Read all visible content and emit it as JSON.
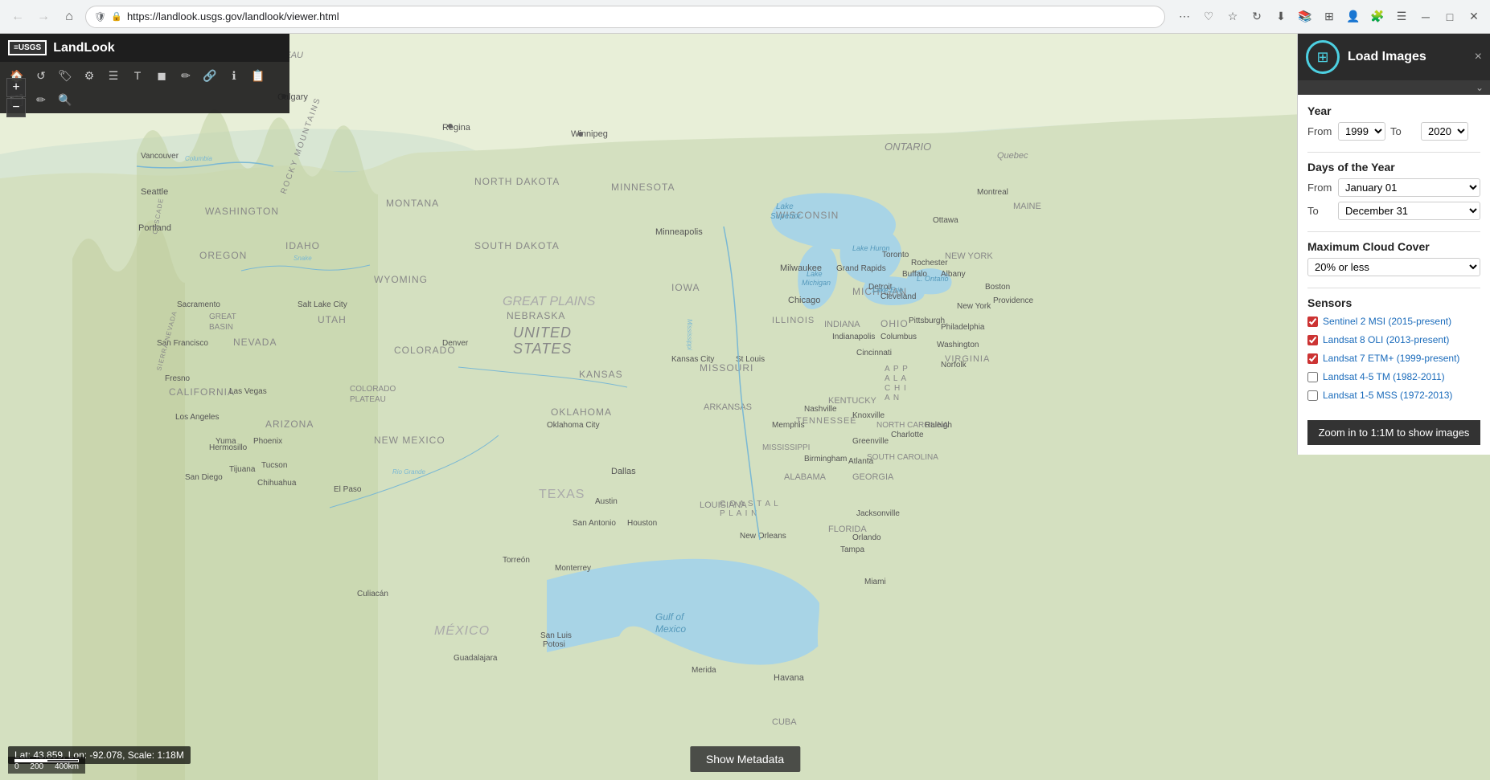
{
  "browser": {
    "url": "https://landlook.usgs.gov/landlook/viewer.html",
    "back_title": "Back",
    "forward_title": "Forward",
    "home_title": "Home",
    "refresh_title": "Refresh"
  },
  "toolbar": {
    "title": "LandLook",
    "logo_text": "≡USGS"
  },
  "panel": {
    "title": "Load Images",
    "year_label": "Year",
    "from_label": "From",
    "to_label": "To",
    "year_from": "1999",
    "year_to": "2020",
    "days_label": "Days of the Year",
    "days_from_label": "From",
    "days_from_value": "January 01",
    "days_to_label": "To",
    "days_to_value": "December 31",
    "cloud_cover_label": "Maximum Cloud Cover",
    "cloud_cover_value": "20% or less",
    "sensors_label": "Sensors",
    "sensor1_label": "Sentinel 2 MSI (2015-present)",
    "sensor2_label": "Landsat 8 OLI (2013-present)",
    "sensor3_label": "Landsat 7 ETM+ (1999-present)",
    "sensor4_label": "Landsat 4-5 TM (1982-2011)",
    "sensor5_label": "Landsat 1-5 MSS (1972-2013)",
    "zoom_btn_label": "Zoom in to 1:1M to show images",
    "close_label": "×"
  },
  "status": {
    "coordinates": "Lat: 43.859, Lon: -92.078, Scale: 1:18M"
  },
  "scale": {
    "label0": "0",
    "label1": "200",
    "label2": "400km"
  },
  "metadata_btn": "Show Metadata",
  "tools": [
    "🏠",
    "↺",
    "🏷",
    "⚙",
    "≡",
    "T",
    "◼",
    "✏",
    "🔗",
    "ℹ",
    "📋",
    "🗂",
    "✏",
    "🔍"
  ]
}
